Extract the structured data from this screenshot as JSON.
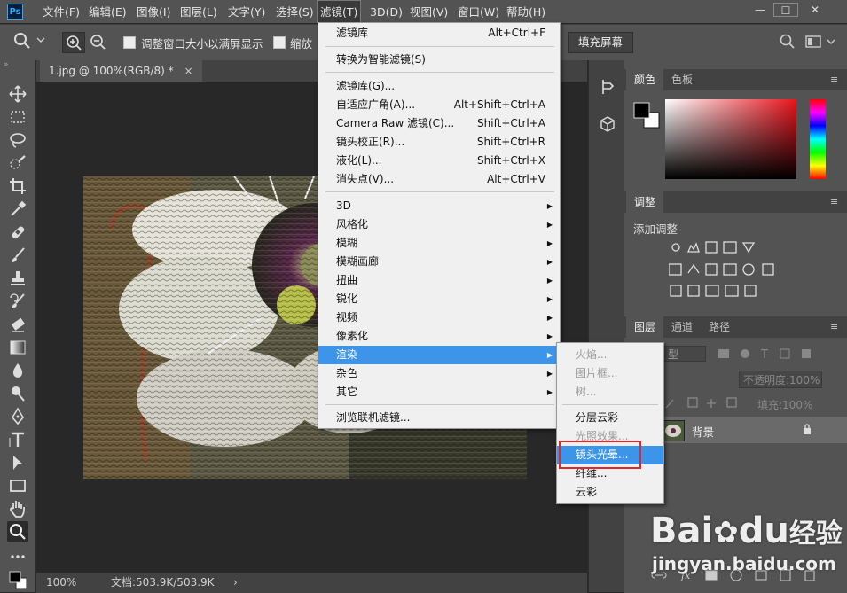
{
  "menubar": {
    "logo": "Ps",
    "items": [
      "文件(F)",
      "编辑(E)",
      "图像(I)",
      "图层(L)",
      "文字(Y)",
      "选择(S)",
      "滤镜(T)",
      "3D(D)",
      "视图(V)",
      "窗口(W)",
      "帮助(H)"
    ],
    "window_controls": [
      "—",
      "☐",
      "✕"
    ]
  },
  "options": {
    "resize_windows": "调整窗口大小以满屏显示",
    "zoom_all": "缩放",
    "fill_screen": "填充屏幕"
  },
  "document": {
    "tab_title": "1.jpg @ 100%(RGB/8) *",
    "tab_close": "×",
    "zoom": "100%",
    "doc_size": "文档:503.9K/503.9K",
    "status_arrow": "›"
  },
  "filter_menu": {
    "groups": [
      [
        {
          "label": "滤镜库",
          "shortcut": "Alt+Ctrl+F"
        }
      ],
      [
        {
          "label": "转换为智能滤镜(S)",
          "shortcut": ""
        }
      ],
      [
        {
          "label": "滤镜库(G)...",
          "shortcut": ""
        },
        {
          "label": "自适应广角(A)...",
          "shortcut": "Alt+Shift+Ctrl+A"
        },
        {
          "label": "Camera Raw 滤镜(C)...",
          "shortcut": "Shift+Ctrl+A"
        },
        {
          "label": "镜头校正(R)...",
          "shortcut": "Shift+Ctrl+R"
        },
        {
          "label": "液化(L)...",
          "shortcut": "Shift+Ctrl+X"
        },
        {
          "label": "消失点(V)...",
          "shortcut": "Alt+Ctrl+V"
        }
      ],
      [
        {
          "label": "3D",
          "submenu": true
        },
        {
          "label": "风格化",
          "submenu": true
        },
        {
          "label": "模糊",
          "submenu": true
        },
        {
          "label": "模糊画廊",
          "submenu": true
        },
        {
          "label": "扭曲",
          "submenu": true
        },
        {
          "label": "锐化",
          "submenu": true
        },
        {
          "label": "视频",
          "submenu": true
        },
        {
          "label": "像素化",
          "submenu": true
        },
        {
          "label": "渲染",
          "submenu": true,
          "highlighted": true
        },
        {
          "label": "杂色",
          "submenu": true
        },
        {
          "label": "其它",
          "submenu": true
        }
      ],
      [
        {
          "label": "浏览联机滤镜...",
          "shortcut": ""
        }
      ]
    ]
  },
  "render_submenu": {
    "items": [
      {
        "label": "火焰...",
        "disabled": true
      },
      {
        "label": "图片框...",
        "disabled": true
      },
      {
        "label": "树...",
        "disabled": true
      },
      {
        "label": "分层云彩",
        "disabled": false
      },
      {
        "label": "光照效果...",
        "disabled": true
      },
      {
        "label": "镜头光晕...",
        "disabled": false,
        "highlighted": true
      },
      {
        "label": "纤维...",
        "disabled": false
      },
      {
        "label": "云彩",
        "disabled": false
      }
    ]
  },
  "panels": {
    "color_tabs": [
      "颜色",
      "色板"
    ],
    "adjust_tab": "调整",
    "add_adjustment": "添加调整",
    "layers_tabs": [
      "图层",
      "通道",
      "路径"
    ],
    "kind_label": "型",
    "opacity_label": "不透明度:",
    "opacity_value": "100%",
    "fill_label": "填充:",
    "fill_value": "100%",
    "layer_name": "背景",
    "menu_glyph": "≡"
  },
  "watermark": {
    "brand": "Bai",
    "brand2": "du",
    "brand_cn": "经验",
    "url": "jingyan.baidu.com"
  },
  "colors": {
    "ui_dark": "#535353",
    "menu_highlight": "#3d95ea",
    "callout_red": "#e0272b",
    "ps_blue": "#31a8ff"
  }
}
